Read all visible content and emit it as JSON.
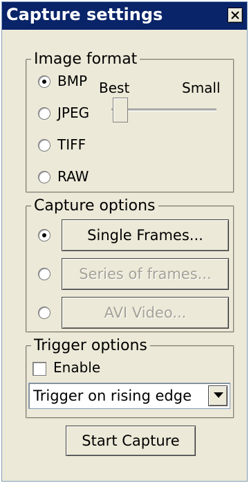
{
  "window": {
    "title": "Capture settings"
  },
  "image_format": {
    "legend": "Image format",
    "options": [
      "BMP",
      "JPEG",
      "TIFF",
      "RAW"
    ],
    "selected": "BMP",
    "slider": {
      "min_label": "Best",
      "max_label": "Small",
      "value": 0
    }
  },
  "capture_options": {
    "legend": "Capture options",
    "buttons": [
      {
        "label": "Single Frames...",
        "enabled": true,
        "selected": true
      },
      {
        "label": "Series of frames...",
        "enabled": false,
        "selected": false
      },
      {
        "label": "AVI Video...",
        "enabled": false,
        "selected": false
      }
    ]
  },
  "trigger_options": {
    "legend": "Trigger options",
    "enable_label": "Enable",
    "enable_checked": false,
    "mode_value": "Trigger on rising edge"
  },
  "actions": {
    "start_label": "Start Capture"
  },
  "icons": {
    "close": "close-icon",
    "dropdown": "chevron-down-icon"
  },
  "colors": {
    "titlebar": "#0a246a",
    "window_bg": "#ece9d8",
    "disabled_text": "#a5a196"
  }
}
